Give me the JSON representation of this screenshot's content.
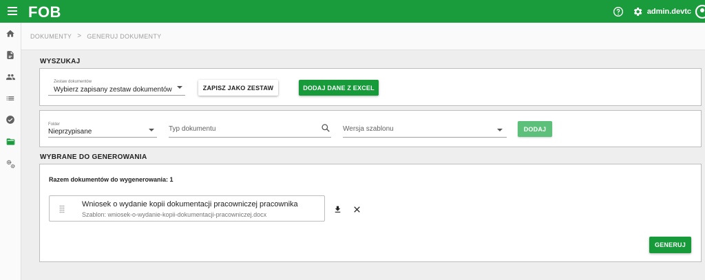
{
  "app": {
    "logo": "FOB"
  },
  "header": {
    "user_name": "admin.devtc"
  },
  "sidebar": {
    "items": [
      {
        "icon": "home-icon"
      },
      {
        "icon": "document-icon"
      },
      {
        "icon": "people-icon"
      },
      {
        "icon": "list-icon"
      },
      {
        "icon": "check-circle-icon"
      },
      {
        "icon": "folder-open-icon"
      },
      {
        "icon": "settings-cogs-icon"
      }
    ]
  },
  "breadcrumb": {
    "items": [
      "DOKUMENTY",
      "GENERUJ DOKUMENTY"
    ],
    "separator": ">"
  },
  "search": {
    "title": "WYSZUKAJ",
    "set_label": "Zestaw dokumentów",
    "set_value": "Wybierz zapisany zestaw dokumentów",
    "save_set_button": "ZAPISZ JAKO ZESTAW",
    "excel_button": "DODAJ DANE Z EXCEL"
  },
  "filters": {
    "folder_label": "Folder",
    "folder_value": "Nieprzypisane",
    "doc_type_placeholder": "Typ dokumentu",
    "template_version_placeholder": "Wersja szablonu",
    "add_button": "DODAJ"
  },
  "selected": {
    "title": "WYBRANE DO GENEROWANIA",
    "total_label": "Razem dokumentów do wygenerowania: 1",
    "documents": [
      {
        "title": "Wniosek o wydanie kopii dokumentacji pracowniczej pracownika",
        "template": "Szablon: wniosek-o-wydanie-kopii-dokumentacji-pracowniczej.docx"
      }
    ],
    "generate_button": "GENERUJ"
  },
  "colors": {
    "brand_green": "#1a9b3c",
    "button_green": "#169a3a",
    "button_green_disabled": "#5cc07a",
    "active_icon": "#1a9b3c"
  }
}
